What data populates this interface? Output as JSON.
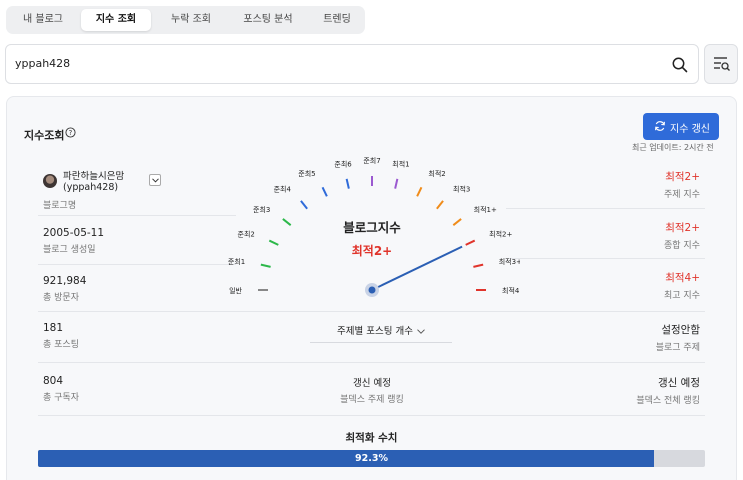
{
  "tabs": [
    "내 블로그",
    "지수 조회",
    "누락 조회",
    "포스팅 분석",
    "트렌딩"
  ],
  "active_tab": 1,
  "search": {
    "value": "yppah428"
  },
  "panel": {
    "title": "지수조회",
    "refresh_label": "지수 갱신",
    "updated_text": "최근 업데이트:  2시간 전"
  },
  "left": {
    "blog_name": "파란하늘시은맘",
    "blog_id": "(yppah428)",
    "blog_name_label": "블로그명",
    "created": {
      "value": "2005-05-11",
      "label": "블로그 생성일"
    },
    "visitors": {
      "value": "921,984",
      "label": "총 방문자"
    },
    "posts": {
      "value": "181",
      "label": "총 포스팅"
    },
    "subscribers": {
      "value": "804",
      "label": "총 구독자"
    }
  },
  "right": {
    "topic_index": {
      "value": "최적2+",
      "label": "주제 지수"
    },
    "total_index": {
      "value": "최적2+",
      "label": "종합 지수"
    },
    "max_index": {
      "value": "최적4+",
      "label": "최고 지수"
    },
    "blog_topic": {
      "value": "설정안함",
      "label": "블로그 주제"
    },
    "overall_rank": {
      "value": "갱신 예정",
      "label": "블덱스 전체 랭킹"
    }
  },
  "gauge": {
    "title": "블로그지수",
    "value": "최적2+",
    "levels": [
      "일반",
      "준최1",
      "준최2",
      "준최3",
      "준최4",
      "준최5",
      "준최6",
      "준최7",
      "최적1",
      "최적2",
      "최적3",
      "최적1+",
      "최적2+",
      "최적3+",
      "최적4+"
    ],
    "level_colors": [
      "#888888",
      "#2db84a",
      "#2db84a",
      "#2db84a",
      "#2f6bd9",
      "#2f6bd9",
      "#2f6bd9",
      "#9b59d0",
      "#9b59d0",
      "#f08c1a",
      "#f08c1a",
      "#f08c1a",
      "#e0342b",
      "#e0342b",
      "#e0342b"
    ],
    "needle_level": "최적2+"
  },
  "middle": {
    "select_label": "주제별 포스팅 개수",
    "topic_rank": {
      "value": "갱신 예정",
      "label": "블덱스 주제 랭킹"
    }
  },
  "optimization": {
    "title": "최적화 수치",
    "percent_text": "92.3%",
    "percent": 92.3
  }
}
